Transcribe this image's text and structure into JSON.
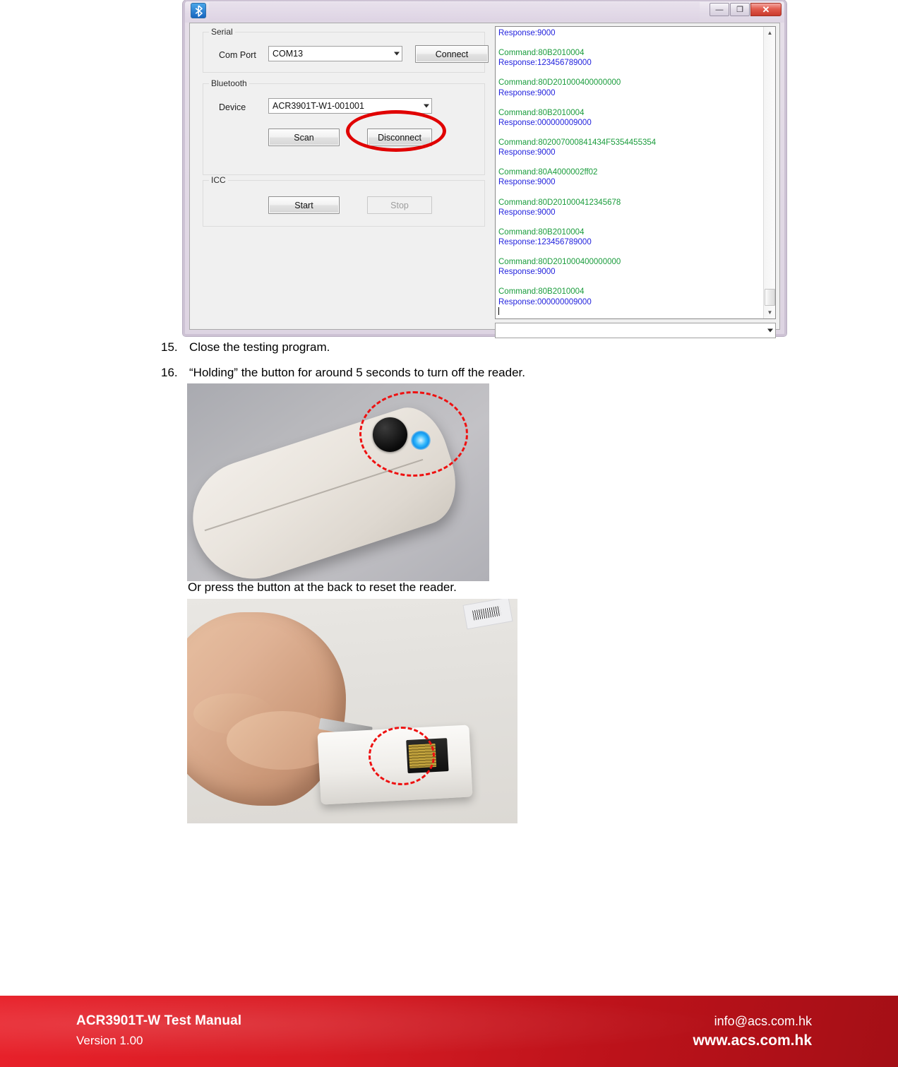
{
  "app_window": {
    "title": "",
    "title_icon": "bluetooth-icon",
    "window_controls": {
      "minimize": "—",
      "maximize": "❐",
      "close": "✕"
    },
    "groups": {
      "serial": {
        "legend": "Serial",
        "com_port_label": "Com Port",
        "com_port_value": "COM13",
        "connect_button": "Connect"
      },
      "bluetooth": {
        "legend": "Bluetooth",
        "device_label": "Device",
        "device_value": "ACR3901T-W1-001001",
        "scan_button": "Scan",
        "disconnect_button": "Disconnect"
      },
      "icc": {
        "legend": "ICC",
        "start_button": "Start",
        "stop_button": "Stop"
      }
    },
    "log": {
      "entries": [
        {
          "type": "response",
          "text": "Response:9000"
        },
        {
          "type": "blank",
          "text": ""
        },
        {
          "type": "command",
          "text": "Command:80B2010004"
        },
        {
          "type": "response",
          "text": "Response:123456789000"
        },
        {
          "type": "blank",
          "text": ""
        },
        {
          "type": "command",
          "text": "Command:80D201000400000000"
        },
        {
          "type": "response",
          "text": "Response:9000"
        },
        {
          "type": "blank",
          "text": ""
        },
        {
          "type": "command",
          "text": "Command:80B2010004"
        },
        {
          "type": "response",
          "text": "Response:000000009000"
        },
        {
          "type": "blank",
          "text": ""
        },
        {
          "type": "command",
          "text": "Command:802007000841434F5354455354"
        },
        {
          "type": "response",
          "text": "Response:9000"
        },
        {
          "type": "blank",
          "text": ""
        },
        {
          "type": "command",
          "text": "Command:80A4000002ff02"
        },
        {
          "type": "response",
          "text": "Response:9000"
        },
        {
          "type": "blank",
          "text": ""
        },
        {
          "type": "command",
          "text": "Command:80D201000412345678"
        },
        {
          "type": "response",
          "text": "Response:9000"
        },
        {
          "type": "blank",
          "text": ""
        },
        {
          "type": "command",
          "text": "Command:80B2010004"
        },
        {
          "type": "response",
          "text": "Response:123456789000"
        },
        {
          "type": "blank",
          "text": ""
        },
        {
          "type": "command",
          "text": "Command:80D201000400000000"
        },
        {
          "type": "response",
          "text": "Response:9000"
        },
        {
          "type": "blank",
          "text": ""
        },
        {
          "type": "command",
          "text": "Command:80B2010004"
        },
        {
          "type": "response",
          "text": "Response:000000009000"
        }
      ],
      "command_color": "#1a9c3c",
      "response_color": "#2222dd"
    },
    "highlight_color": "#e00000"
  },
  "steps": [
    {
      "number": "15.",
      "text": "Close the testing program."
    },
    {
      "number": "16.",
      "text": "“Holding” the button for around 5 seconds to turn off the reader."
    }
  ],
  "caption": "Or press the button at the back to reset the reader.",
  "photos": {
    "photo_1": {
      "alt": "white ACR3901T-W reader with black button and blue LED, red dash-dot ellipse highlight"
    },
    "photo_2": {
      "alt": "hand pressing the reset button at the back of the reader with a pin, red dash-dot ellipse highlight"
    }
  },
  "footer": {
    "manual_title": "ACR3901T-W Test Manual",
    "version": "Version 1.00",
    "email": "info@acs.com.hk",
    "website": "www.acs.com.hk",
    "background_color": "#d81c24"
  }
}
